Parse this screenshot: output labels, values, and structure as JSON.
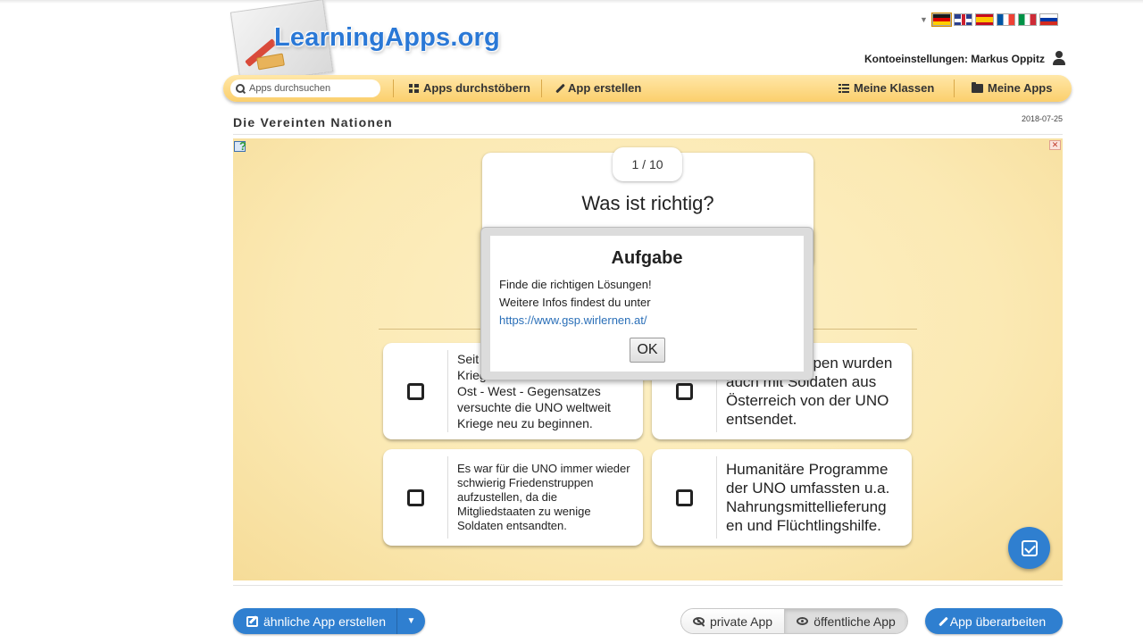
{
  "header": {
    "logo_text": "LearningApps.org",
    "account_label": "Kontoeinstellungen: Markus Oppitz",
    "languages": [
      "de",
      "en",
      "es",
      "fr",
      "it",
      "ru"
    ]
  },
  "navbar": {
    "search_placeholder": "Apps durchsuchen",
    "browse_label": "Apps durchstöbern",
    "create_label": "App erstellen",
    "classes_label": "Meine Klassen",
    "my_apps_label": "Meine Apps"
  },
  "page": {
    "title": "Die Vereinten Nationen",
    "date": "2018-07-25"
  },
  "quiz": {
    "counter": "1 / 10",
    "question": "Was ist richtig?",
    "answers": [
      {
        "text": "Seit ... Krieg ... Ost - West - Gegensatzes versuchte die UNO weltweit Kriege neu zu beginnen."
      },
      {
        "text": "... ppen wurden auch mit Soldaten aus Österreich von der UNO entsendet."
      },
      {
        "text": "Es war für die UNO immer wieder schwierig Friedenstruppen aufzustellen, da die Mitgliedstaaten zu wenige Soldaten entsandten."
      },
      {
        "text": "Humanitäre Programme der UNO umfassten u.a. Nahrungsmittellieferung en und Flüchtlingshilfe."
      }
    ],
    "answer_1_visible": {
      "line1": "Seit",
      "line2": "Krieg",
      "line3": "Ost - West - Gegensatzes",
      "line4": "versuchte die UNO weltweit",
      "line5": "Kriege neu zu beginnen."
    },
    "answer_2_visible": {
      "line1": "ppen wurden",
      "line2": "auch mit Soldaten aus",
      "line3": "Österreich von der UNO",
      "line4": "entsendet."
    }
  },
  "dialog": {
    "title": "Aufgabe",
    "line1": "Finde die richtigen Lösungen!",
    "line2": "Weitere Infos findest du unter",
    "link": "https://www.gsp.wirlernen.at/",
    "ok_label": "OK"
  },
  "footer": {
    "similar_label": "ähnliche App erstellen",
    "private_label": "private App",
    "public_label": "öffentliche App",
    "edit_label": "App überarbeiten"
  },
  "colors": {
    "accent_blue": "#2f7fd0",
    "navbar_yellow": "#fbcf6c",
    "app_background": "#fbe9b3"
  }
}
